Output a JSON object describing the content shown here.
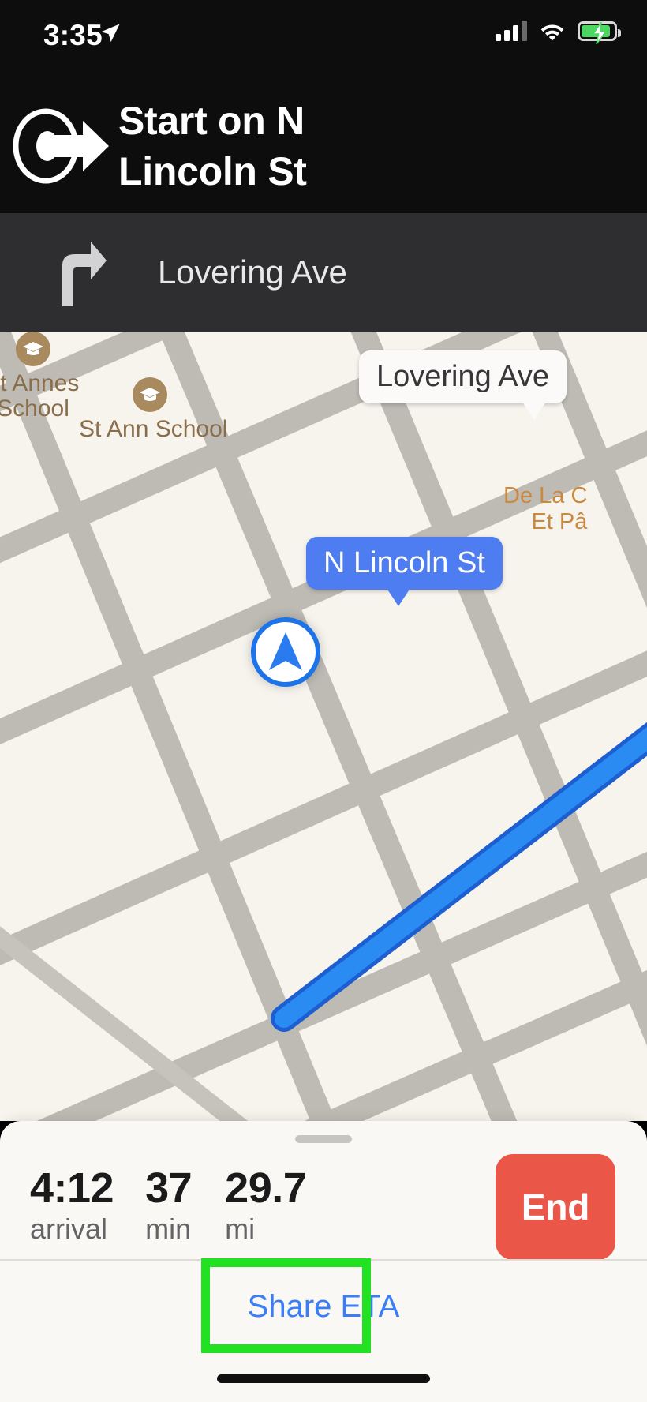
{
  "status_bar": {
    "time": "3:35",
    "location_arrow_icon": "location-arrow-icon",
    "cellular_icon": "cellular-bars-icon",
    "wifi_icon": "wifi-icon",
    "battery_icon": "battery-charging-icon"
  },
  "navigation": {
    "maneuver_icon": "depart-start-icon",
    "instruction": "Start on N Lincoln St",
    "next_step": {
      "icon": "turn-right-icon",
      "street": "Lovering Ave"
    }
  },
  "map": {
    "pois": [
      {
        "name": "Saint Annes School",
        "label_line1": "nt Annes",
        "label_line2": "School",
        "icon": "school-icon"
      },
      {
        "name": "St Ann School",
        "label_line1": "St Ann School",
        "label_line2": "",
        "icon": "school-icon"
      }
    ],
    "callouts": [
      {
        "text": "Lovering Ave",
        "style": "white"
      },
      {
        "text": "N Lincoln St",
        "style": "blue"
      }
    ],
    "street_labels": [
      {
        "line1": "De La C",
        "line2": "Et Pâ"
      }
    ],
    "user_location_icon": "navigation-puck-icon",
    "route_color": "#1d73e8"
  },
  "bottom_sheet": {
    "grabber": "drag-handle",
    "stats": [
      {
        "value": "4:12",
        "unit": "arrival"
      },
      {
        "value": "37",
        "unit": "min"
      },
      {
        "value": "29.7",
        "unit": "mi"
      }
    ],
    "end_button_label": "End",
    "end_button_color": "#ea5648",
    "share_eta_label": "Share ETA",
    "share_eta_color": "#3b7df5",
    "highlight_color": "#22e022"
  }
}
